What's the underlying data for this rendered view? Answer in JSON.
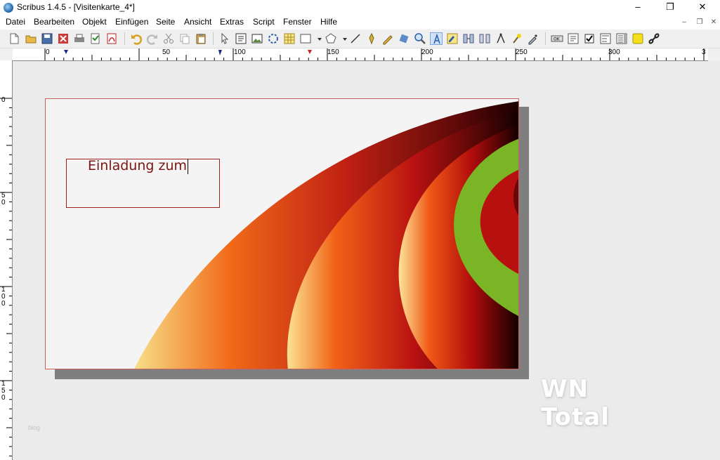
{
  "window": {
    "title": "Scribus 1.4.5 - [Visitenkarte_4*]",
    "minimize": "–",
    "maximize": "❐",
    "close": "✕"
  },
  "menubar": {
    "items": [
      "Datei",
      "Bearbeiten",
      "Objekt",
      "Einfügen",
      "Seite",
      "Ansicht",
      "Extras",
      "Script",
      "Fenster",
      "Hilfe"
    ],
    "mdi": [
      "–",
      "❐",
      "✕"
    ]
  },
  "toolbar": {
    "icons": [
      "new-document-icon",
      "open-icon",
      "save-icon",
      "close-doc-icon",
      "print-icon",
      "preflight-icon",
      "export-pdf-icon",
      "undo-icon",
      "redo-icon",
      "cut-icon",
      "copy-icon",
      "paste-icon",
      "select-icon",
      "text-frame-icon",
      "image-frame-icon",
      "render-frame-icon",
      "table-icon",
      "shape-icon",
      "polygon-icon",
      "line-icon",
      "bezier-icon",
      "freehand-icon",
      "rotate-icon",
      "zoom-icon",
      "edit-text-icon",
      "story-editor-icon",
      "link-frames-icon",
      "unlink-frames-icon",
      "measure-icon",
      "copy-properties-icon",
      "eyedropper-icon",
      "pdf-button-icon",
      "pdf-textfield-icon",
      "pdf-checkbox-icon",
      "pdf-combobox-icon",
      "pdf-listbox-icon",
      "pdf-annotation-icon",
      "pdf-link-icon"
    ]
  },
  "ruler": {
    "h_labels": [
      "0",
      "50",
      "100",
      "150",
      "200",
      "250",
      "300",
      "3"
    ],
    "v_labels": [
      "0",
      "5\n0",
      "1\n0\n0",
      "1\n5\n0"
    ]
  },
  "document": {
    "text_frame_content": "Einladung zum",
    "colors": {
      "page_border": "#c86060",
      "frame_border": "#a02020",
      "text": "#7a1515",
      "green_band": "#7ab526",
      "dark_red": "#b80f0f"
    }
  },
  "watermark": {
    "text": "WN Total"
  },
  "footer": {
    "blog": "blog"
  }
}
